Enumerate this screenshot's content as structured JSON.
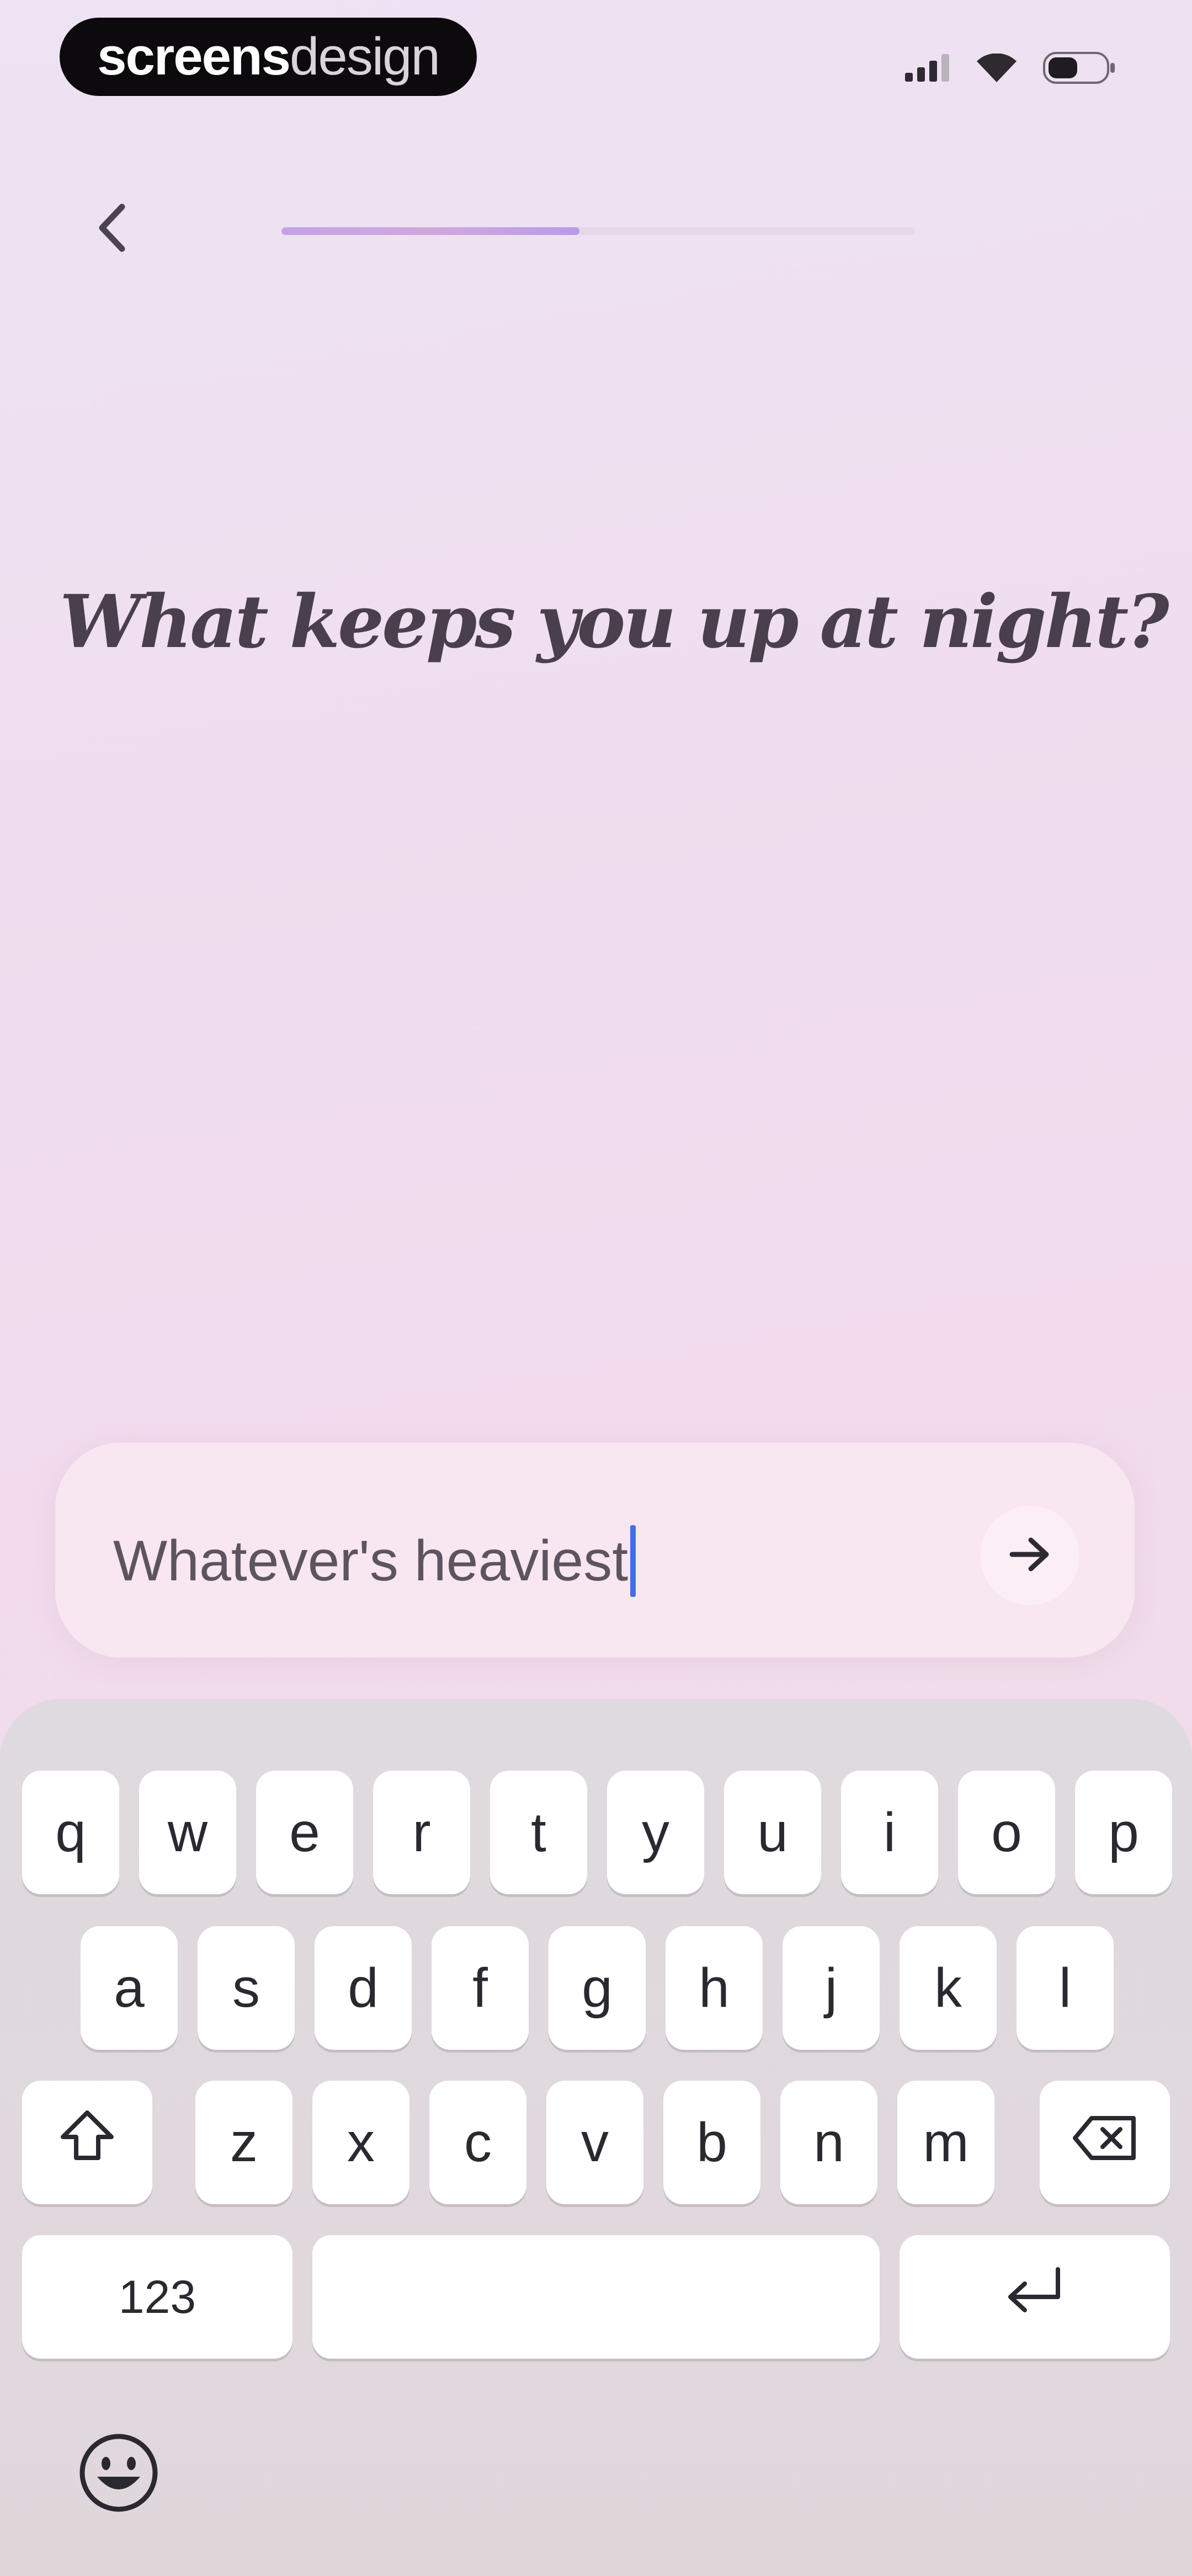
{
  "status_bar": {
    "brand_strong": "screens",
    "brand_light": "design",
    "icons": [
      "signal-icon",
      "wifi-icon",
      "battery-icon"
    ]
  },
  "nav": {
    "back_icon": "chevron-left-icon",
    "progress_fraction": 0.47
  },
  "question": {
    "title": "What keeps you up at night?"
  },
  "answer": {
    "value": "Whatever's heaviest",
    "submit_icon": "arrow-right-icon"
  },
  "keyboard": {
    "row1": [
      "q",
      "w",
      "e",
      "r",
      "t",
      "y",
      "u",
      "i",
      "o",
      "p"
    ],
    "row2": [
      "a",
      "s",
      "d",
      "f",
      "g",
      "h",
      "j",
      "k",
      "l"
    ],
    "row3": [
      "z",
      "x",
      "c",
      "v",
      "b",
      "n",
      "m"
    ],
    "numbers_label": "123",
    "space_hint": "",
    "icons": [
      "shift-icon",
      "backspace-icon",
      "return-icon",
      "emoji-icon"
    ]
  },
  "colors": {
    "accent": "#c3a2e4",
    "caret": "#3f6fe8",
    "title_text": "#4a3f4c"
  }
}
